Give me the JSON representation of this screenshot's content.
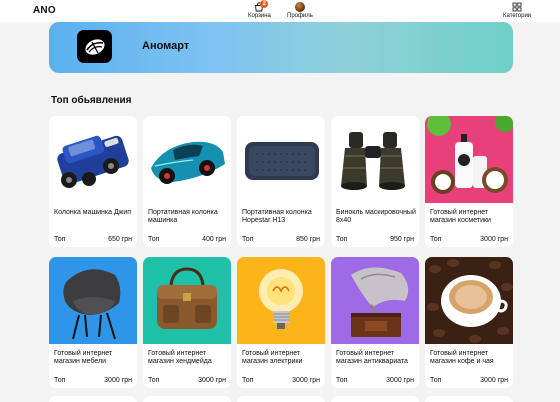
{
  "header": {
    "logo": "ANO",
    "cart_label": "Корзина",
    "cart_count": "2",
    "profile_label": "Профиль",
    "categories_label": "Категории"
  },
  "store": {
    "name": "Аномарт"
  },
  "section": {
    "title": "Топ обьявления"
  },
  "products": [
    {
      "title": "Колонка машинка Джип",
      "tag": "Топ",
      "price": "650 грн",
      "icon": "blue-jeep-speaker-image"
    },
    {
      "title": "Портативная колонка машинка",
      "tag": "Топ",
      "price": "400 грн",
      "icon": "teal-sportscar-speaker-image"
    },
    {
      "title": "Портативная колонка Hopestar H13",
      "tag": "Топ",
      "price": "850 грн",
      "icon": "hopestar-speaker-image"
    },
    {
      "title": "Бинокль маскировочный 8х40",
      "tag": "Топ",
      "price": "950 грн",
      "icon": "binoculars-image"
    },
    {
      "title": "Готовый интернет магазин косметики",
      "tag": "Топ",
      "price": "3000 грн",
      "icon": "cosmetics-image"
    },
    {
      "title": "Готовый интернет магазин мебели",
      "tag": "Топ",
      "price": "3000 грн",
      "icon": "armchair-image"
    },
    {
      "title": "Готовый интернет магазин хендмейда",
      "tag": "Топ",
      "price": "3000 грн",
      "icon": "leather-bag-image"
    },
    {
      "title": "Готовый интернет магазин электрики",
      "tag": "Топ",
      "price": "3000 грн",
      "icon": "light-bulb-image"
    },
    {
      "title": "Готовый интернет магазин антиквариата",
      "tag": "Топ",
      "price": "3000 грн",
      "icon": "gramophone-image"
    },
    {
      "title": "Готовый интернет магазин кофе и чая",
      "tag": "Топ",
      "price": "3000 грн",
      "icon": "coffee-cup-image"
    }
  ],
  "colors": {
    "accent": "#f25a1c",
    "banner_start": "#5ab0ee",
    "banner_end": "#6fd0c8",
    "page_bg": "#f3f3f3"
  }
}
